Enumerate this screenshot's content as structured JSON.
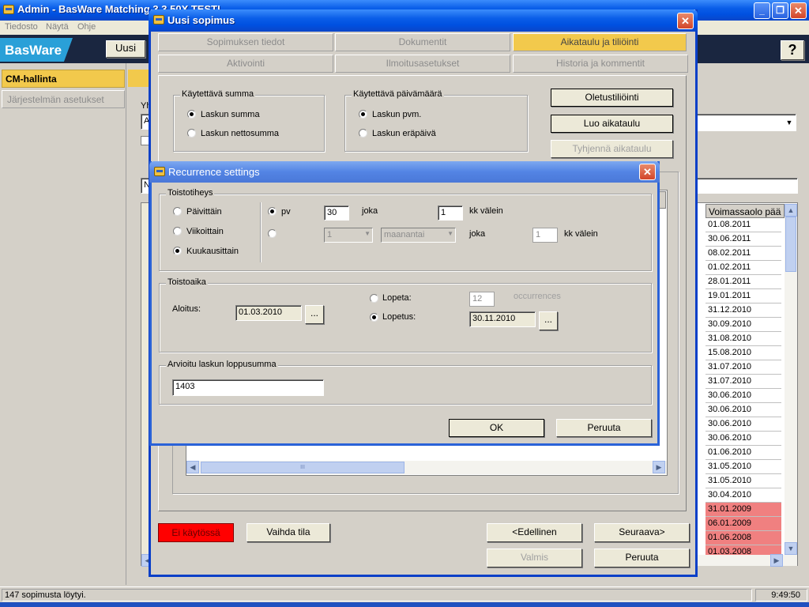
{
  "main_window": {
    "title": "Admin - BasWare Matching 3.3.50X TESTI",
    "menu": [
      "Tiedosto",
      "Näytä",
      "Ohje"
    ],
    "brand": "BasWare",
    "toolbar_new": "Uusi",
    "help_glyph": "?",
    "sidebar": [
      "CM-hallinta",
      "Järjestelmän asetukset"
    ],
    "bg_fragment_yh": "Yh",
    "bg_fragment_a": "A",
    "bg_fragment_n": "N",
    "grid_header": "Voimassaolo pää",
    "grid_dates": [
      "01.08.2011",
      "30.06.2011",
      "08.02.2011",
      "01.02.2011",
      "28.01.2011",
      "19.01.2011",
      "31.12.2010",
      "30.09.2010",
      "31.08.2010",
      "15.08.2010",
      "31.07.2010",
      "31.07.2010",
      "30.06.2010",
      "30.06.2010",
      "30.06.2010",
      "30.06.2010",
      "01.06.2010",
      "31.05.2010",
      "31.05.2010",
      "30.04.2010",
      "31.01.2009",
      "06.01.2009",
      "01.06.2008",
      "01.03.2008"
    ],
    "grid_red_from_index": 20,
    "status_text": "147 sopimusta löytyi.",
    "clock": "9:49:50"
  },
  "contract_dialog": {
    "title": "Uusi sopimus",
    "tabs_row1": [
      "Sopimuksen tiedot",
      "Dokumentit",
      "Aikataulu ja tiliöinti"
    ],
    "tabs_row2": [
      "Aktivointi",
      "Ilmoitusasetukset",
      "Historia ja kommentit"
    ],
    "active_tab": "Aikataulu ja tiliöinti",
    "sum_group": {
      "label": "Käytettävä summa",
      "options": [
        "Laskun summa",
        "Laskun nettosumma"
      ],
      "selected": 0
    },
    "date_group": {
      "label": "Käytettävä päivämäärä",
      "options": [
        "Laskun pvm.",
        "Laskun eräpäivä"
      ],
      "selected": 0
    },
    "btn_default_account": "Oletustiliöinti",
    "btn_create_schedule": "Luo aikataulu",
    "btn_clear_schedule": "Tyhjennä aikataulu",
    "status_badge": "Ei käytössä",
    "btn_change_state": "Vaihda tila",
    "btn_prev": "<Edellinen",
    "btn_next": "Seuraava>",
    "btn_done": "Valmis",
    "btn_cancel": "Peruuta",
    "inner_hscroll_thumb": "III"
  },
  "recurrence_dialog": {
    "title": "Recurrence settings",
    "frequency": {
      "label": "Toistotiheys",
      "options": [
        "Päivittäin",
        "Viikoittain",
        "Kuukausittain"
      ],
      "selected": 2,
      "row1_unit": "pv",
      "row1_value": "30",
      "row1_every": "joka",
      "row1_interval": "1",
      "row1_interval_label": "kk välein",
      "row2_number": "1",
      "row2_weekday": "maanantai",
      "row2_every": "joka",
      "row2_interval": "1",
      "row2_interval_label": "kk välein"
    },
    "range": {
      "label": "Toistoaika",
      "start_label": "Aloitus:",
      "start_value": "01.03.2010",
      "end_after_label": "Lopeta:",
      "end_after_value": "12",
      "occurrences_label": "occurrences",
      "end_by_label": "Lopetus:",
      "end_by_value": "30.11.2010",
      "browse": "..."
    },
    "estimate": {
      "label": "Arvioitu laskun loppusumma",
      "value": "1403"
    },
    "ok": "OK",
    "cancel": "Peruuta"
  }
}
